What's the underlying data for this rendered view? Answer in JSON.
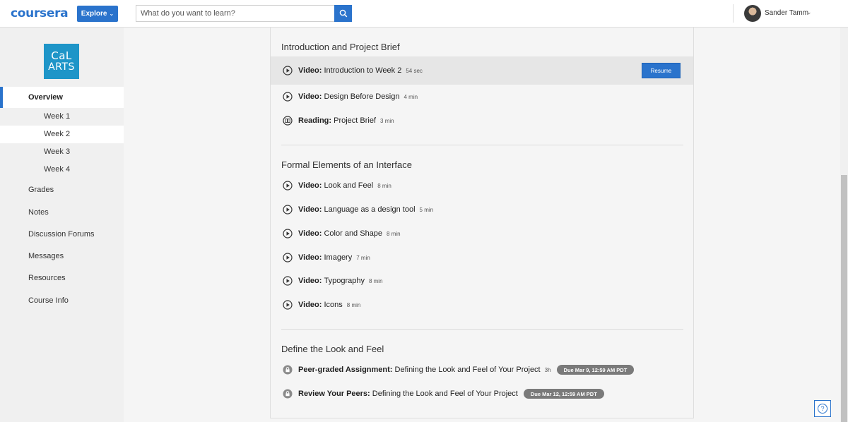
{
  "header": {
    "logo_text": "coursera",
    "explore_label": "Explore",
    "search_placeholder": "What do you want to learn?",
    "user_name": "Sander Tamm"
  },
  "sidebar": {
    "school_logo_line1": "CaL",
    "school_logo_line2": "ARTS",
    "overview_label": "Overview",
    "weeks": [
      "Week 1",
      "Week 2",
      "Week 3",
      "Week 4"
    ],
    "active_week": "Week 2",
    "items": [
      "Grades",
      "Notes",
      "Discussion Forums",
      "Messages",
      "Resources",
      "Course Info"
    ]
  },
  "sections": [
    {
      "title": "Introduction and Project Brief",
      "items": [
        {
          "icon": "play-icon",
          "kind": "Video:",
          "name": "Introduction to Week 2",
          "duration": "54 sec",
          "action": "Resume"
        },
        {
          "icon": "play-icon",
          "kind": "Video:",
          "name": "Design Before Design",
          "duration": "4 min"
        },
        {
          "icon": "book-icon",
          "kind": "Reading:",
          "name": "Project Brief",
          "duration": "3 min"
        }
      ]
    },
    {
      "title": "Formal Elements of an Interface",
      "items": [
        {
          "icon": "play-icon",
          "kind": "Video:",
          "name": "Look and Feel",
          "duration": "8 min"
        },
        {
          "icon": "play-icon",
          "kind": "Video:",
          "name": "Language as a design tool",
          "duration": "5 min"
        },
        {
          "icon": "play-icon",
          "kind": "Video:",
          "name": "Color and Shape",
          "duration": "8 min"
        },
        {
          "icon": "play-icon",
          "kind": "Video:",
          "name": "Imagery",
          "duration": "7 min"
        },
        {
          "icon": "play-icon",
          "kind": "Video:",
          "name": "Typography",
          "duration": "8 min"
        },
        {
          "icon": "play-icon",
          "kind": "Video:",
          "name": "Icons",
          "duration": "8 min"
        }
      ]
    },
    {
      "title": "Define the Look and Feel",
      "items": [
        {
          "icon": "lock-icon",
          "kind": "Peer-graded Assignment:",
          "name": "Defining the Look and Feel of Your Project",
          "duration": "3h",
          "due": "Due Mar 9, 12:59 AM PDT"
        },
        {
          "icon": "lock-icon",
          "kind": "Review Your Peers:",
          "name": "Defining the Look and Feel of Your Project",
          "duration": "",
          "due": "Due Mar 12, 12:59 AM PDT"
        }
      ]
    }
  ],
  "colors": {
    "accent": "#2a73cc",
    "school": "#1e95c8",
    "pill": "#7a7a7a"
  }
}
